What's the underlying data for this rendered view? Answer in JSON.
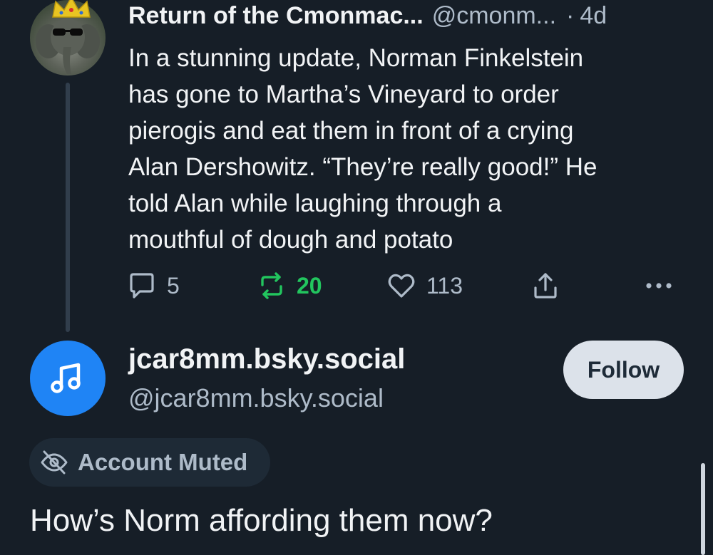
{
  "post1": {
    "author_name": "Return of the Cmonmac...",
    "author_handle": "@cmonm...",
    "separator": "·",
    "timestamp": "4d",
    "avatar_icon": "elephant-with-crown-avatar",
    "text_lines": [
      "In a stunning update, Norman Finkelstein",
      "has gone to Martha’s Vineyard to order",
      "pierogis and eat them in front of a crying",
      "Alan Dershowitz. “They’re really good!” He",
      "told Alan while laughing through a",
      "mouthful of dough and potato"
    ],
    "actions": {
      "reply_count": "5",
      "repost_count": "20",
      "like_count": "113"
    },
    "colors": {
      "repost_active": "#22c55e"
    }
  },
  "post2": {
    "author_name": "jcar8mm.bsky.social",
    "author_handle": "@jcar8mm.bsky.social",
    "avatar_icon": "music-note-icon",
    "avatar_color": "#1f84f5",
    "follow_label": "Follow",
    "muted_label": "Account Muted",
    "text": "How’s Norm affording them now?"
  },
  "theme": {
    "background": "#161e27",
    "text_primary": "#f1f3f5",
    "text_secondary": "#aebbc9"
  }
}
